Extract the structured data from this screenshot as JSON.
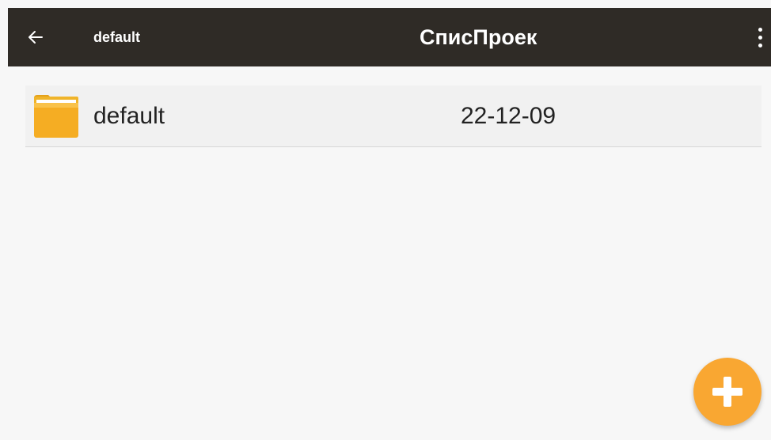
{
  "app_bar": {
    "breadcrumb": "default",
    "title": "СписПроек",
    "back_icon": "arrow-left-icon",
    "menu_icon": "more-vert-icon"
  },
  "projects": [
    {
      "name": "default",
      "date": "22-12-09",
      "icon": "folder-icon"
    }
  ],
  "fab": {
    "icon": "plus-icon",
    "color": "#f9a732"
  },
  "colors": {
    "app_bar": "#2f2b26",
    "background": "#f7f7f7",
    "accent": "#f9a732"
  }
}
